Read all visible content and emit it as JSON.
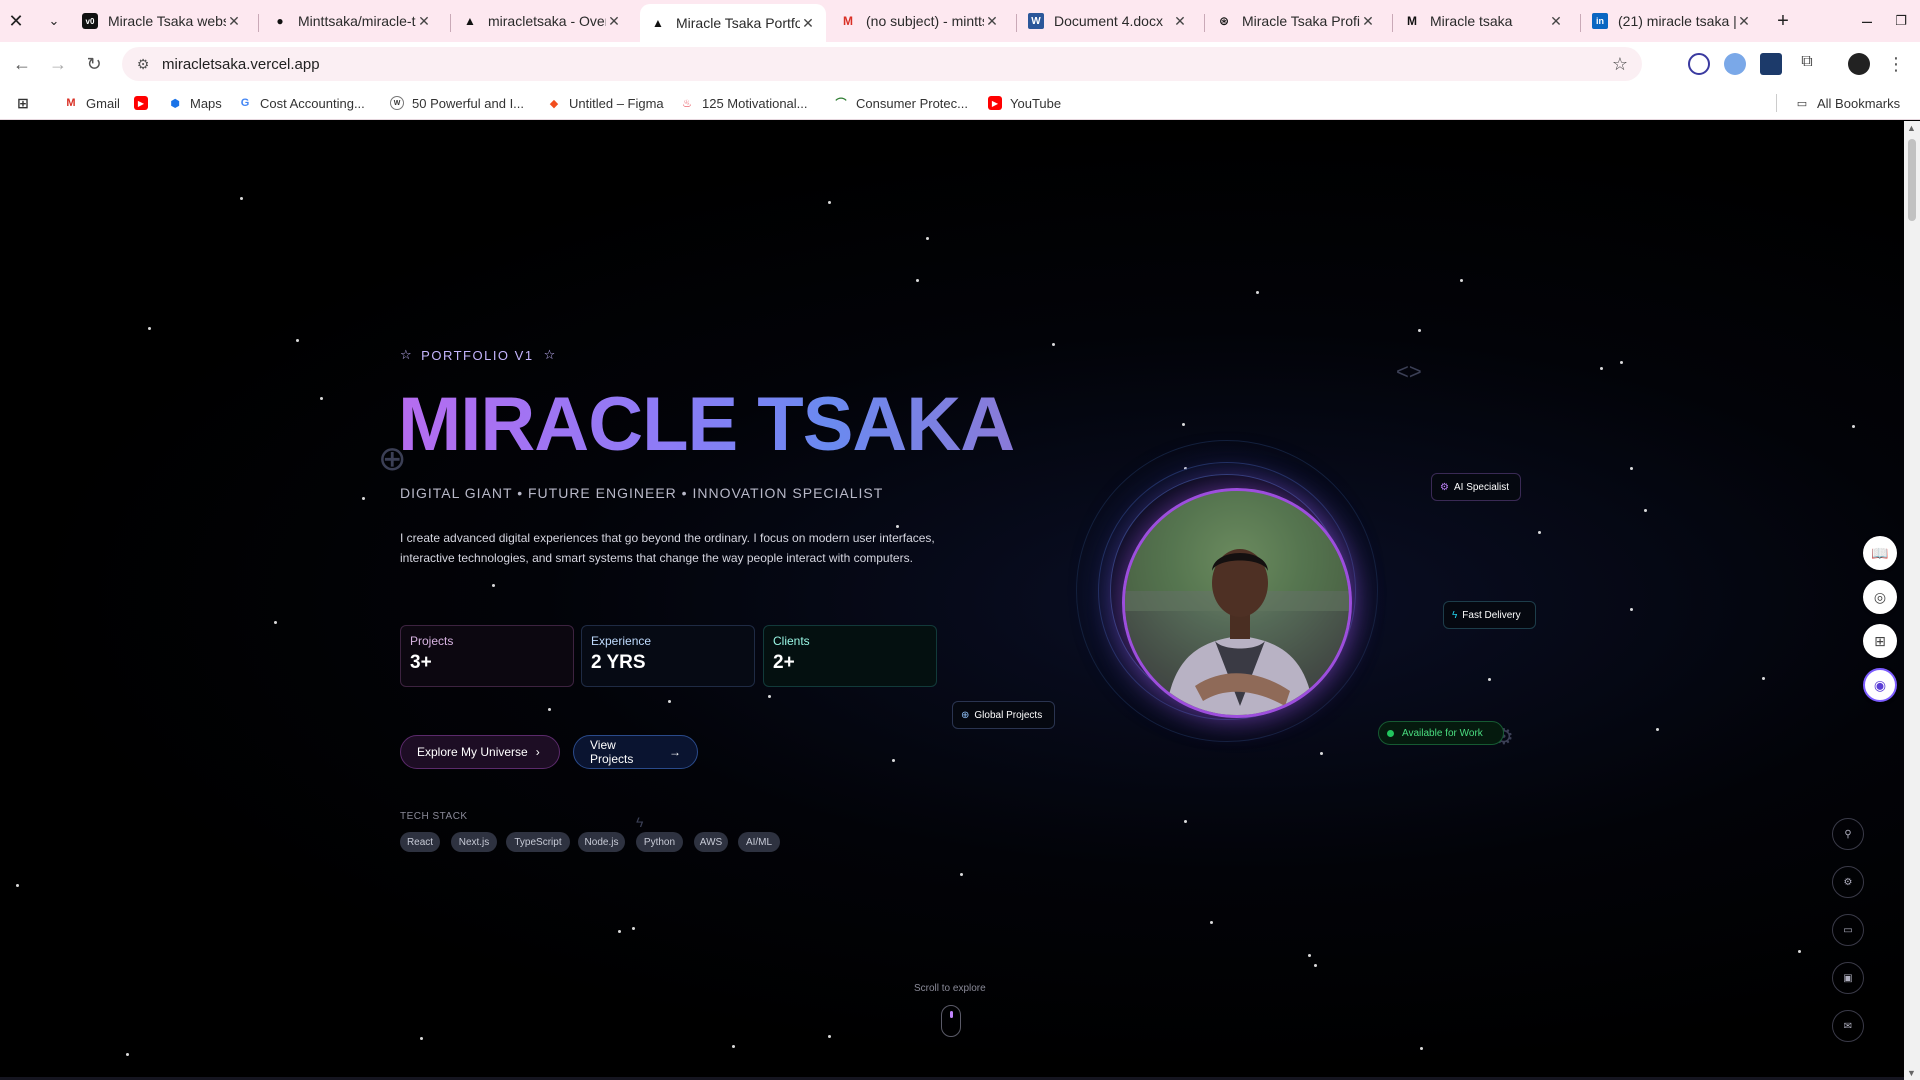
{
  "browser": {
    "tabs": [
      {
        "title": "Miracle Tsaka websi",
        "icon": "vercel-v0-icon"
      },
      {
        "title": "Minttsaka/miracle-t",
        "icon": "github-icon"
      },
      {
        "title": "miracletsaka - Overv",
        "icon": "vercel-icon"
      },
      {
        "title": "Miracle Tsaka Portfo",
        "icon": "vercel-icon",
        "active": true
      },
      {
        "title": "(no subject) - mintts",
        "icon": "gmail-icon"
      },
      {
        "title": "Document 4.docx",
        "icon": "word-icon"
      },
      {
        "title": "Miracle Tsaka Profil",
        "icon": "openai-icon"
      },
      {
        "title": "Miracle tsaka",
        "icon": "medium-icon"
      },
      {
        "title": "(21) miracle tsaka | l",
        "icon": "linkedin-icon"
      }
    ],
    "url": "miracletsaka.vercel.app",
    "bookmarks": [
      {
        "label": "Gmail",
        "icon": "gmail-icon"
      },
      {
        "label": "",
        "icon": "youtube-icon"
      },
      {
        "label": "Maps",
        "icon": "maps-icon"
      },
      {
        "label": "Cost Accounting...",
        "icon": "google-icon"
      },
      {
        "label": "50 Powerful and I...",
        "icon": "site-icon"
      },
      {
        "label": "Untitled – Figma",
        "icon": "figma-icon"
      },
      {
        "label": "125 Motivational...",
        "icon": "site-icon"
      },
      {
        "label": "Consumer Protec...",
        "icon": "site-icon"
      },
      {
        "label": "YouTube",
        "icon": "youtube-icon"
      }
    ],
    "all_bookmarks": "All Bookmarks"
  },
  "hero": {
    "badge": "PORTFOLIO V1",
    "name": "MIRACLE TSAKA",
    "tagline": "DIGITAL GIANT • FUTURE ENGINEER • INNOVATION SPECIALIST",
    "intro": "I create advanced digital experiences that go beyond the ordinary. I focus on modern user interfaces, interactive technologies, and smart systems that change the way people interact with computers.",
    "stats": [
      {
        "label": "Projects",
        "value": "3+"
      },
      {
        "label": "Experience",
        "value": "2 YRS"
      },
      {
        "label": "Clients",
        "value": "2+"
      }
    ],
    "cta_explore": "Explore My Universe",
    "cta_view": "View Projects",
    "tech_label": "TECH STACK",
    "tech": [
      "React",
      "Next.js",
      "TypeScript",
      "Node.js",
      "Python",
      "AWS",
      "AI/ML"
    ]
  },
  "portrait": {
    "badge_ai": "AI Specialist",
    "badge_fast": "Fast Delivery",
    "badge_global": "Global Projects",
    "badge_available": "Available for Work"
  },
  "scroll_hint": "Scroll to explore",
  "colors": {
    "accent_purple": "#9d4edd",
    "accent_blue": "#6a8af0",
    "available_green": "#22c55e"
  }
}
